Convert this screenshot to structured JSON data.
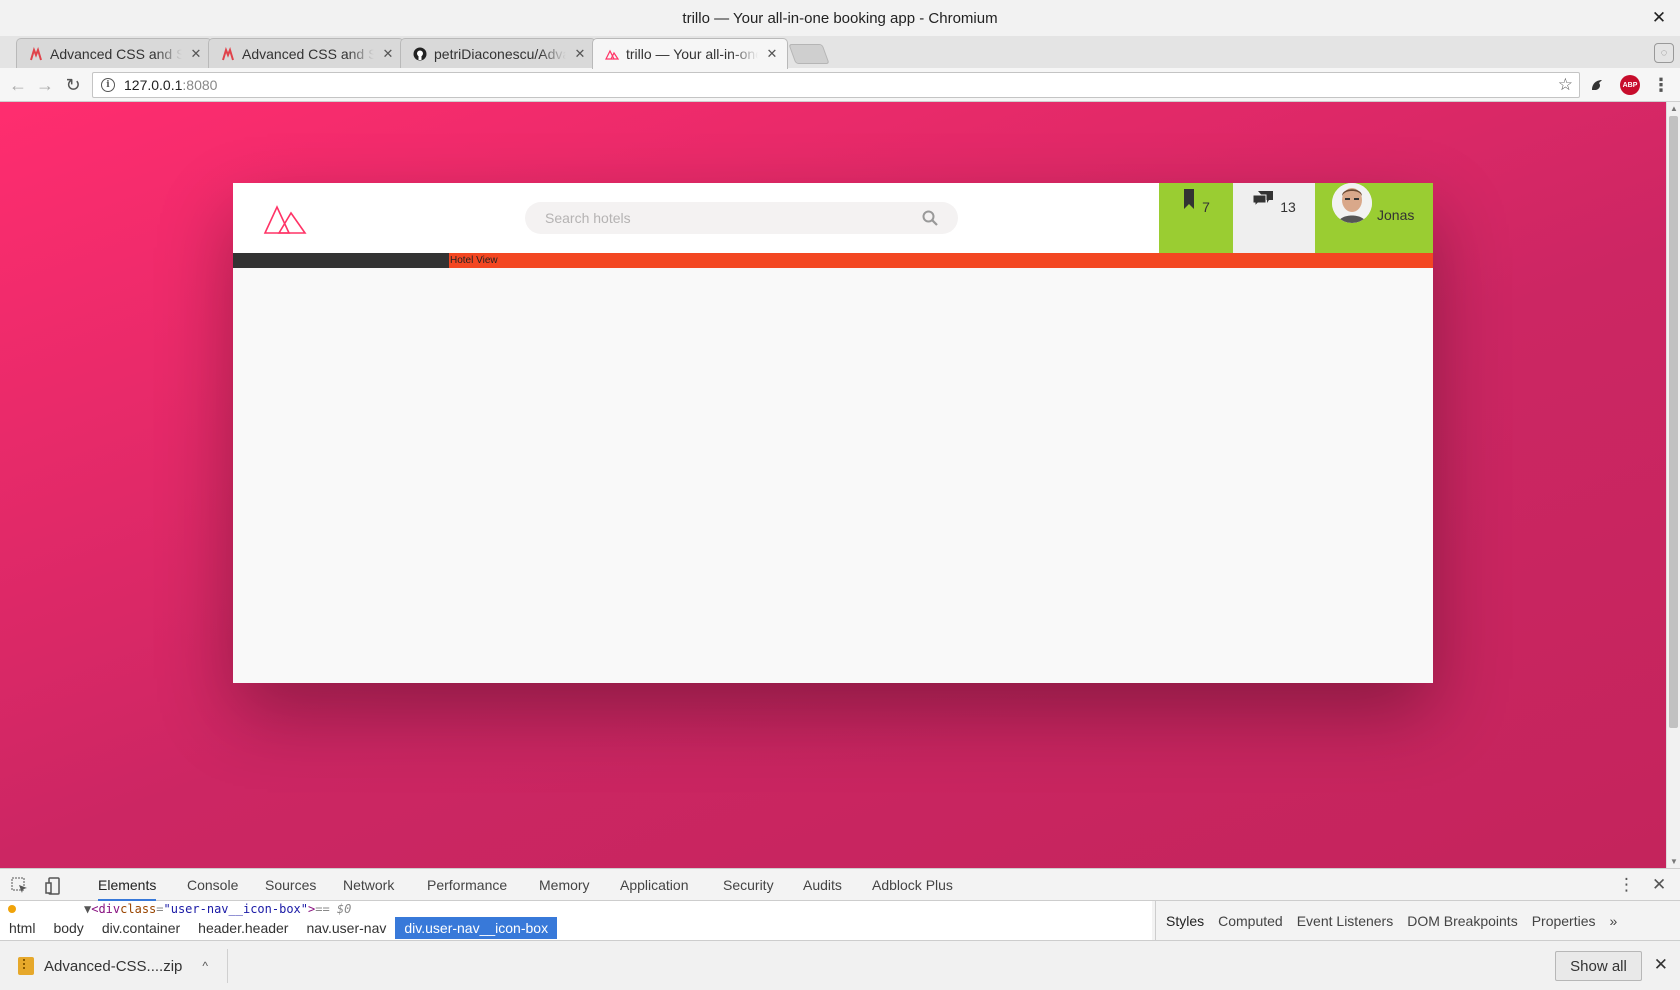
{
  "window": {
    "title": "trillo — Your all-in-one booking app - Chromium"
  },
  "tabs": [
    {
      "title": "Advanced CSS and Sass",
      "favicon": "udemy-icon",
      "active": false
    },
    {
      "title": "Advanced CSS and Sass",
      "favicon": "udemy-icon",
      "active": false
    },
    {
      "title": "petriDiaconescu/Advanced-CSS",
      "favicon": "github-icon",
      "active": false
    },
    {
      "title": "trillo — Your all-in-one booking app",
      "favicon": "trillo-logo-icon",
      "active": true
    }
  ],
  "toolbar": {
    "url_host": "127.0.0.1",
    "url_port": ":8080"
  },
  "page": {
    "search": {
      "placeholder": "Search hotels"
    },
    "bookmarks_count": "7",
    "messages_count": "13",
    "user_name": "Jonas",
    "hotel_view_label": "Hotel View",
    "colors": {
      "background_gradient_start": "#ff2d6f",
      "background_gradient_end": "#c4245c",
      "icon_box_green": "#9acd32",
      "sidebar_dark": "#333333",
      "hotel_view_orange": "#f34722"
    }
  },
  "devtools": {
    "tabs": [
      "Elements",
      "Console",
      "Sources",
      "Network",
      "Performance",
      "Memory",
      "Application",
      "Security",
      "Audits",
      "Adblock Plus"
    ],
    "active_tab": "Elements",
    "dom_line": {
      "tag_open": "<div",
      "attr": "class",
      "value": "\"user-nav__icon-box\"",
      "tag_close": ">",
      "marker": "== $0"
    },
    "breadcrumbs": [
      "html",
      "body",
      "div.container",
      "header.header",
      "nav.user-nav",
      "div.user-nav__icon-box"
    ],
    "sidebar_tabs": [
      "Styles",
      "Computed",
      "Event Listeners",
      "DOM Breakpoints",
      "Properties"
    ]
  },
  "downloads": {
    "file_name": "Advanced-CSS....zip",
    "show_all_label": "Show all"
  }
}
